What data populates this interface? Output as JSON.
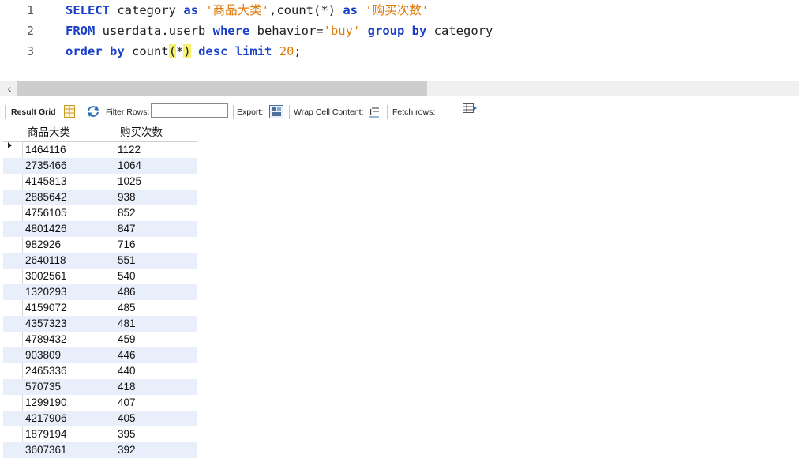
{
  "editor": {
    "lines": [
      {
        "num": "1",
        "parts": [
          {
            "t": "SELECT",
            "k": "kw"
          },
          {
            "t": " category ",
            "k": ""
          },
          {
            "t": "as",
            "k": "kw"
          },
          {
            "t": " ",
            "k": ""
          },
          {
            "t": "'商品大类'",
            "k": "str"
          },
          {
            "t": ",count(*) ",
            "k": ""
          },
          {
            "t": "as",
            "k": "kw"
          },
          {
            "t": " ",
            "k": ""
          },
          {
            "t": "'购买次数'",
            "k": "str"
          }
        ]
      },
      {
        "num": "2",
        "parts": [
          {
            "t": "FROM",
            "k": "kw"
          },
          {
            "t": " userdata.userb ",
            "k": ""
          },
          {
            "t": "where",
            "k": "kw"
          },
          {
            "t": " behavior=",
            "k": ""
          },
          {
            "t": "'buy'",
            "k": "str"
          },
          {
            "t": " ",
            "k": ""
          },
          {
            "t": "group",
            "k": "kw"
          },
          {
            "t": " ",
            "k": ""
          },
          {
            "t": "by",
            "k": "kw"
          },
          {
            "t": " category",
            "k": ""
          }
        ]
      },
      {
        "num": "3",
        "parts": [
          {
            "t": "order",
            "k": "kw"
          },
          {
            "t": " ",
            "k": ""
          },
          {
            "t": "by",
            "k": "kw"
          },
          {
            "t": " count",
            "k": ""
          },
          {
            "t": "(",
            "k": "hl"
          },
          {
            "t": "*",
            "k": ""
          },
          {
            "t": ")",
            "k": "hl"
          },
          {
            "t": " ",
            "k": ""
          },
          {
            "t": "desc",
            "k": "kw"
          },
          {
            "t": " ",
            "k": ""
          },
          {
            "t": "limit",
            "k": "kw"
          },
          {
            "t": " ",
            "k": ""
          },
          {
            "t": "20",
            "k": "num"
          },
          {
            "t": ";",
            "k": ""
          }
        ]
      }
    ]
  },
  "toolbar": {
    "result_grid": "Result Grid",
    "filter_rows": "Filter Rows:",
    "filter_value": "",
    "export": "Export:",
    "wrap": "Wrap Cell Content:",
    "fetch": "Fetch rows:"
  },
  "grid": {
    "columns": [
      "商品大类",
      "购买次数"
    ],
    "rows": [
      [
        "1464116",
        "1122"
      ],
      [
        "2735466",
        "1064"
      ],
      [
        "4145813",
        "1025"
      ],
      [
        "2885642",
        "938"
      ],
      [
        "4756105",
        "852"
      ],
      [
        "4801426",
        "847"
      ],
      [
        "982926",
        "716"
      ],
      [
        "2640118",
        "551"
      ],
      [
        "3002561",
        "540"
      ],
      [
        "1320293",
        "486"
      ],
      [
        "4159072",
        "485"
      ],
      [
        "4357323",
        "481"
      ],
      [
        "4789432",
        "459"
      ],
      [
        "903809",
        "446"
      ],
      [
        "2465336",
        "440"
      ],
      [
        "570735",
        "418"
      ],
      [
        "1299190",
        "407"
      ],
      [
        "4217906",
        "405"
      ],
      [
        "1879194",
        "395"
      ],
      [
        "3607361",
        "392"
      ]
    ]
  }
}
